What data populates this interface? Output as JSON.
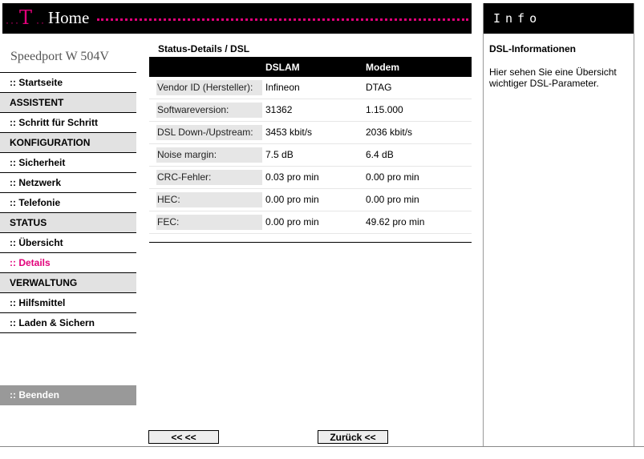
{
  "header": {
    "logo_letter": "T",
    "title": "Home",
    "dots_left": "···",
    "dots_mid": "··",
    "accent_color": "#e2007a"
  },
  "brand": "Speedport W 504V",
  "nav": {
    "items": [
      {
        "label": ":: Startseite",
        "type": "link"
      },
      {
        "label": "ASSISTENT",
        "type": "section"
      },
      {
        "label": ":: Schritt für Schritt",
        "type": "link"
      },
      {
        "label": "KONFIGURATION",
        "type": "section"
      },
      {
        "label": ":: Sicherheit",
        "type": "link"
      },
      {
        "label": ":: Netzwerk",
        "type": "link"
      },
      {
        "label": ":: Telefonie",
        "type": "link"
      },
      {
        "label": "STATUS",
        "type": "section"
      },
      {
        "label": ":: Übersicht",
        "type": "link"
      },
      {
        "label": ":: Details",
        "type": "link",
        "active": true
      },
      {
        "label": "VERWALTUNG",
        "type": "section"
      },
      {
        "label": ":: Hilfsmittel",
        "type": "link"
      },
      {
        "label": ":: Laden & Sichern",
        "type": "link"
      }
    ],
    "logout": ":: Beenden"
  },
  "main": {
    "breadcrumb": "Status-Details / DSL",
    "columns": [
      "DSLAM",
      "Modem"
    ],
    "rows": [
      {
        "label": "Vendor ID (Hersteller):",
        "dslam": "Infineon",
        "modem": "DTAG"
      },
      {
        "label": "Softwareversion:",
        "dslam": "31362",
        "modem": "1.15.000"
      },
      {
        "label": "DSL Down-/Upstream:",
        "dslam": "3453 kbit/s",
        "modem": "2036 kbit/s"
      },
      {
        "label": "Noise margin:",
        "dslam": "7.5 dB",
        "modem": "6.4 dB"
      },
      {
        "label": "CRC-Fehler:",
        "dslam": "0.03 pro min",
        "modem": "0.00 pro min"
      },
      {
        "label": "HEC:",
        "dslam": "0.00 pro min",
        "modem": "0.00 pro min"
      },
      {
        "label": "FEC:",
        "dslam": "0.00 pro min",
        "modem": "49.62 pro min"
      }
    ],
    "buttons": {
      "back": "<<  <<",
      "zurueck": "Zurück <<"
    }
  },
  "info": {
    "header": "Info",
    "title": "DSL-Informationen",
    "text": "Hier sehen Sie eine Übersicht wichtiger DSL-Parameter."
  }
}
